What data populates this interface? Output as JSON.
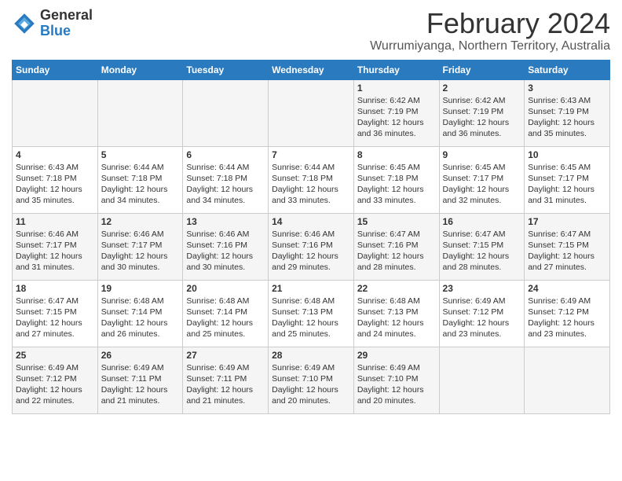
{
  "logo": {
    "general": "General",
    "blue": "Blue"
  },
  "title": "February 2024",
  "location": "Wurrumiyanga, Northern Territory, Australia",
  "days_of_week": [
    "Sunday",
    "Monday",
    "Tuesday",
    "Wednesday",
    "Thursday",
    "Friday",
    "Saturday"
  ],
  "weeks": [
    [
      {
        "day": "",
        "info": ""
      },
      {
        "day": "",
        "info": ""
      },
      {
        "day": "",
        "info": ""
      },
      {
        "day": "",
        "info": ""
      },
      {
        "day": "1",
        "info": "Sunrise: 6:42 AM\nSunset: 7:19 PM\nDaylight: 12 hours and 36 minutes."
      },
      {
        "day": "2",
        "info": "Sunrise: 6:42 AM\nSunset: 7:19 PM\nDaylight: 12 hours and 36 minutes."
      },
      {
        "day": "3",
        "info": "Sunrise: 6:43 AM\nSunset: 7:19 PM\nDaylight: 12 hours and 35 minutes."
      }
    ],
    [
      {
        "day": "4",
        "info": "Sunrise: 6:43 AM\nSunset: 7:18 PM\nDaylight: 12 hours and 35 minutes."
      },
      {
        "day": "5",
        "info": "Sunrise: 6:44 AM\nSunset: 7:18 PM\nDaylight: 12 hours and 34 minutes."
      },
      {
        "day": "6",
        "info": "Sunrise: 6:44 AM\nSunset: 7:18 PM\nDaylight: 12 hours and 34 minutes."
      },
      {
        "day": "7",
        "info": "Sunrise: 6:44 AM\nSunset: 7:18 PM\nDaylight: 12 hours and 33 minutes."
      },
      {
        "day": "8",
        "info": "Sunrise: 6:45 AM\nSunset: 7:18 PM\nDaylight: 12 hours and 33 minutes."
      },
      {
        "day": "9",
        "info": "Sunrise: 6:45 AM\nSunset: 7:17 PM\nDaylight: 12 hours and 32 minutes."
      },
      {
        "day": "10",
        "info": "Sunrise: 6:45 AM\nSunset: 7:17 PM\nDaylight: 12 hours and 31 minutes."
      }
    ],
    [
      {
        "day": "11",
        "info": "Sunrise: 6:46 AM\nSunset: 7:17 PM\nDaylight: 12 hours and 31 minutes."
      },
      {
        "day": "12",
        "info": "Sunrise: 6:46 AM\nSunset: 7:17 PM\nDaylight: 12 hours and 30 minutes."
      },
      {
        "day": "13",
        "info": "Sunrise: 6:46 AM\nSunset: 7:16 PM\nDaylight: 12 hours and 30 minutes."
      },
      {
        "day": "14",
        "info": "Sunrise: 6:46 AM\nSunset: 7:16 PM\nDaylight: 12 hours and 29 minutes."
      },
      {
        "day": "15",
        "info": "Sunrise: 6:47 AM\nSunset: 7:16 PM\nDaylight: 12 hours and 28 minutes."
      },
      {
        "day": "16",
        "info": "Sunrise: 6:47 AM\nSunset: 7:15 PM\nDaylight: 12 hours and 28 minutes."
      },
      {
        "day": "17",
        "info": "Sunrise: 6:47 AM\nSunset: 7:15 PM\nDaylight: 12 hours and 27 minutes."
      }
    ],
    [
      {
        "day": "18",
        "info": "Sunrise: 6:47 AM\nSunset: 7:15 PM\nDaylight: 12 hours and 27 minutes."
      },
      {
        "day": "19",
        "info": "Sunrise: 6:48 AM\nSunset: 7:14 PM\nDaylight: 12 hours and 26 minutes."
      },
      {
        "day": "20",
        "info": "Sunrise: 6:48 AM\nSunset: 7:14 PM\nDaylight: 12 hours and 25 minutes."
      },
      {
        "day": "21",
        "info": "Sunrise: 6:48 AM\nSunset: 7:13 PM\nDaylight: 12 hours and 25 minutes."
      },
      {
        "day": "22",
        "info": "Sunrise: 6:48 AM\nSunset: 7:13 PM\nDaylight: 12 hours and 24 minutes."
      },
      {
        "day": "23",
        "info": "Sunrise: 6:49 AM\nSunset: 7:12 PM\nDaylight: 12 hours and 23 minutes."
      },
      {
        "day": "24",
        "info": "Sunrise: 6:49 AM\nSunset: 7:12 PM\nDaylight: 12 hours and 23 minutes."
      }
    ],
    [
      {
        "day": "25",
        "info": "Sunrise: 6:49 AM\nSunset: 7:12 PM\nDaylight: 12 hours and 22 minutes."
      },
      {
        "day": "26",
        "info": "Sunrise: 6:49 AM\nSunset: 7:11 PM\nDaylight: 12 hours and 21 minutes."
      },
      {
        "day": "27",
        "info": "Sunrise: 6:49 AM\nSunset: 7:11 PM\nDaylight: 12 hours and 21 minutes."
      },
      {
        "day": "28",
        "info": "Sunrise: 6:49 AM\nSunset: 7:10 PM\nDaylight: 12 hours and 20 minutes."
      },
      {
        "day": "29",
        "info": "Sunrise: 6:49 AM\nSunset: 7:10 PM\nDaylight: 12 hours and 20 minutes."
      },
      {
        "day": "",
        "info": ""
      },
      {
        "day": "",
        "info": ""
      }
    ]
  ]
}
